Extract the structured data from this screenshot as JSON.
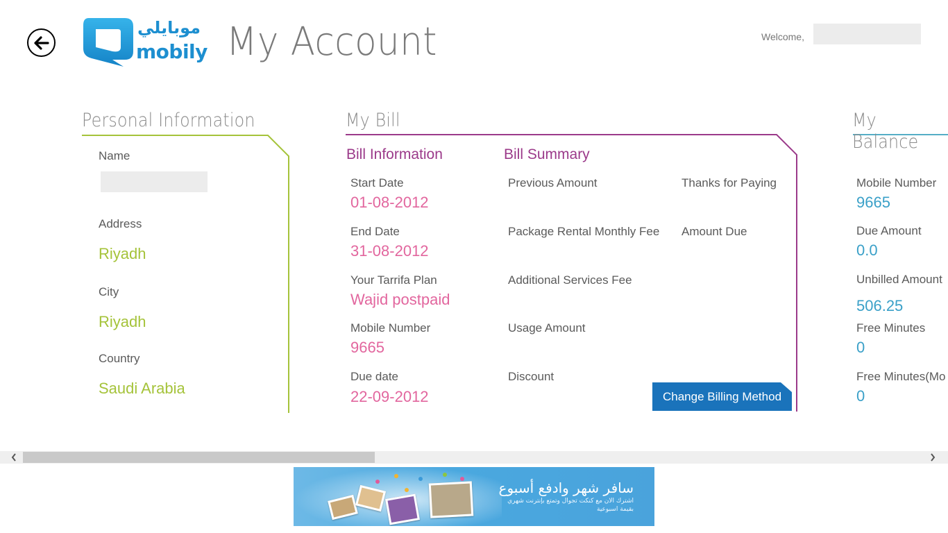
{
  "header": {
    "back_icon": "arrow-left-circle-icon",
    "logo": {
      "arabic": "موبايلي",
      "latin": "mobily",
      "brand_color": "#1d8fd0"
    },
    "title": "My Account",
    "welcome_label": "Welcome,"
  },
  "colors": {
    "personal_accent": "#a5c33a",
    "bill_accent": "#9b3a8a",
    "bill_value": "#e2669e",
    "balance_accent": "#3aa0c8",
    "button_bg": "#1a73bb"
  },
  "personal_info": {
    "title": "Personal Information",
    "fields": [
      {
        "label": "Name",
        "value": ""
      },
      {
        "label": "Address",
        "value": "Riyadh"
      },
      {
        "label": "City",
        "value": "Riyadh"
      },
      {
        "label": "Country",
        "value": "Saudi Arabia"
      }
    ]
  },
  "my_bill": {
    "title": "My Bill",
    "bill_information": {
      "title": "Bill Information",
      "fields": [
        {
          "label": "Start Date",
          "value": "01-08-2012"
        },
        {
          "label": "End Date",
          "value": "31-08-2012"
        },
        {
          "label": "Your Tarrifa Plan",
          "value": "Wajid postpaid"
        },
        {
          "label": "Mobile Number",
          "value": "9665"
        },
        {
          "label": "Due date",
          "value": "22-09-2012"
        }
      ]
    },
    "bill_summary": {
      "title": "Bill Summary",
      "items": [
        "Previous Amount",
        "Package Rental Monthly Fee",
        "Additional Services Fee",
        "Usage Amount",
        "Discount"
      ],
      "right_items": [
        "Thanks for Paying",
        "Amount Due"
      ]
    },
    "change_billing_button": "Change Billing Method"
  },
  "my_balance": {
    "title": "My Balance",
    "fields": [
      {
        "label": "Mobile Number",
        "value": "9665"
      },
      {
        "label": "Due Amount",
        "value": "0.0"
      },
      {
        "label": "Unbilled Amount",
        "value": "506.25"
      },
      {
        "label": "Free Minutes",
        "value": "0"
      },
      {
        "label": "Free Minutes(Mo",
        "value": "0"
      }
    ]
  },
  "scrollbar": {
    "left_arrow": "‹",
    "right_arrow": "›",
    "position_fraction": 0.0,
    "visible_fraction": 0.38
  },
  "banner": {
    "headline": "سافر شهر وادفع أسبوع",
    "line1": "اشترك الان مع كنكت تجوال وتمتع بإنترنت شهري",
    "line2": "بقيمة اسبوعية"
  }
}
